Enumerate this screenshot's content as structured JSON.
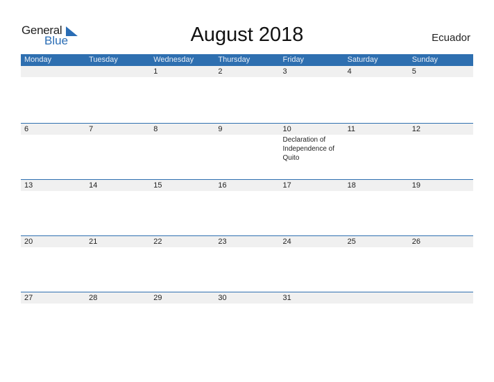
{
  "logo": {
    "text_top": "General",
    "text_bottom": "Blue",
    "icon": "blue-triangle-icon",
    "brand_color": "#2a6db5"
  },
  "title": "August 2018",
  "country": "Ecuador",
  "colors": {
    "header_bg": "#2e6fb0",
    "date_strip_bg": "#f0f0f0"
  },
  "weekdays": [
    "Monday",
    "Tuesday",
    "Wednesday",
    "Thursday",
    "Friday",
    "Saturday",
    "Sunday"
  ],
  "weeks": [
    {
      "days": [
        {
          "num": "",
          "event": ""
        },
        {
          "num": "",
          "event": ""
        },
        {
          "num": "1",
          "event": ""
        },
        {
          "num": "2",
          "event": ""
        },
        {
          "num": "3",
          "event": ""
        },
        {
          "num": "4",
          "event": ""
        },
        {
          "num": "5",
          "event": ""
        }
      ]
    },
    {
      "days": [
        {
          "num": "6",
          "event": ""
        },
        {
          "num": "7",
          "event": ""
        },
        {
          "num": "8",
          "event": ""
        },
        {
          "num": "9",
          "event": ""
        },
        {
          "num": "10",
          "event": "Declaration of Independence of Quito"
        },
        {
          "num": "11",
          "event": ""
        },
        {
          "num": "12",
          "event": ""
        }
      ]
    },
    {
      "days": [
        {
          "num": "13",
          "event": ""
        },
        {
          "num": "14",
          "event": ""
        },
        {
          "num": "15",
          "event": ""
        },
        {
          "num": "16",
          "event": ""
        },
        {
          "num": "17",
          "event": ""
        },
        {
          "num": "18",
          "event": ""
        },
        {
          "num": "19",
          "event": ""
        }
      ]
    },
    {
      "days": [
        {
          "num": "20",
          "event": ""
        },
        {
          "num": "21",
          "event": ""
        },
        {
          "num": "22",
          "event": ""
        },
        {
          "num": "23",
          "event": ""
        },
        {
          "num": "24",
          "event": ""
        },
        {
          "num": "25",
          "event": ""
        },
        {
          "num": "26",
          "event": ""
        }
      ]
    },
    {
      "days": [
        {
          "num": "27",
          "event": ""
        },
        {
          "num": "28",
          "event": ""
        },
        {
          "num": "29",
          "event": ""
        },
        {
          "num": "30",
          "event": ""
        },
        {
          "num": "31",
          "event": ""
        },
        {
          "num": "",
          "event": ""
        },
        {
          "num": "",
          "event": ""
        }
      ]
    }
  ]
}
